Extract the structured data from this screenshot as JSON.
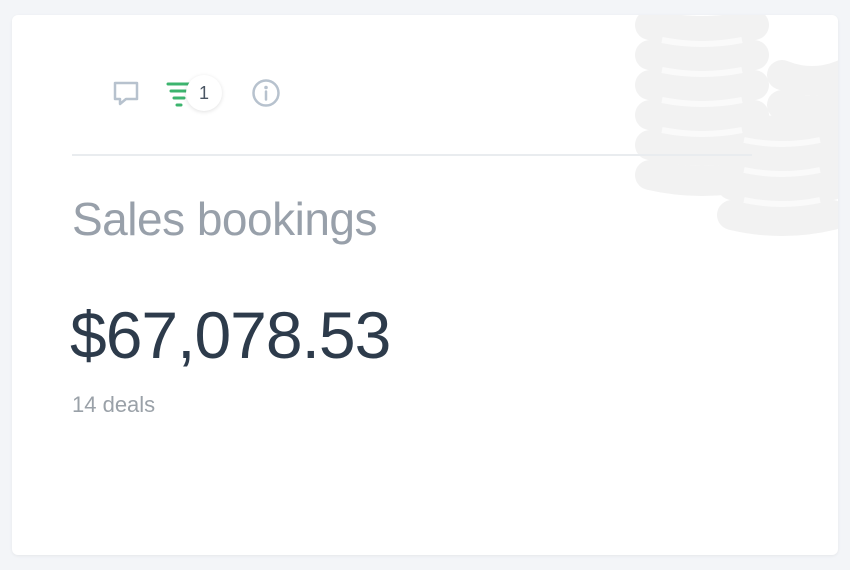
{
  "card": {
    "title": "Sales bookings",
    "amount": "$67,078.53",
    "subtext": "14 deals",
    "background_icon": "coins-icon"
  },
  "toolbar": {
    "comment_icon": "comment-icon",
    "filter_icon": "filter-icon",
    "filter_count": "1",
    "info_icon": "info-icon"
  },
  "colors": {
    "filter_accent": "#3cb46e",
    "icon_gray": "#b7c2ce",
    "title_gray": "#98a0aa",
    "amount_dark": "#2d3b4b"
  }
}
